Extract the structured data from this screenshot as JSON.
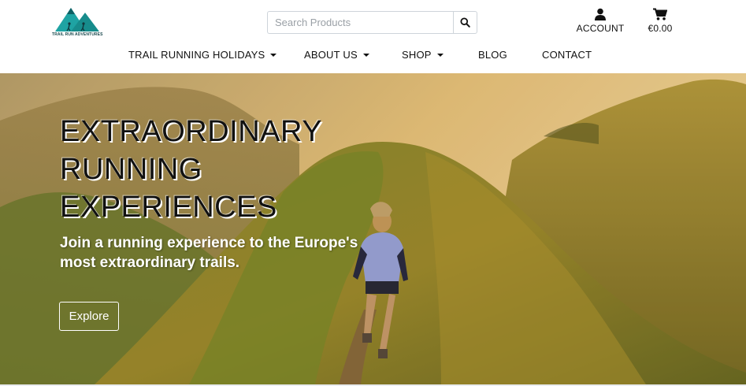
{
  "brand": {
    "logo_text": "TRAIL RUN ADVENTURES",
    "color": "#1fa3a3"
  },
  "search": {
    "placeholder": "Search Products",
    "value": "",
    "icon": "search-icon"
  },
  "header_actions": {
    "account": {
      "label": "ACCOUNT",
      "icon": "user-icon"
    },
    "cart": {
      "label": "€0.00",
      "icon": "shopping-cart-icon"
    }
  },
  "nav": {
    "items": [
      {
        "label": "TRAIL RUNNING HOLIDAYS",
        "dropdown": true
      },
      {
        "label": "ABOUT US",
        "dropdown": true
      },
      {
        "label": "SHOP",
        "dropdown": true
      },
      {
        "label": "BLOG",
        "dropdown": false
      },
      {
        "label": "CONTACT",
        "dropdown": false
      }
    ]
  },
  "hero": {
    "title_lines": [
      "EXTRAORDINARY",
      "RUNNING",
      "EXPERIENCES"
    ],
    "subtitle_lines": [
      "Join a running experience to the Europe's",
      "most extraordinary trails."
    ],
    "cta_label": "Explore"
  },
  "colors": {
    "text": "#111111",
    "hero_text": "#ffffff",
    "border": "#ced4da"
  }
}
